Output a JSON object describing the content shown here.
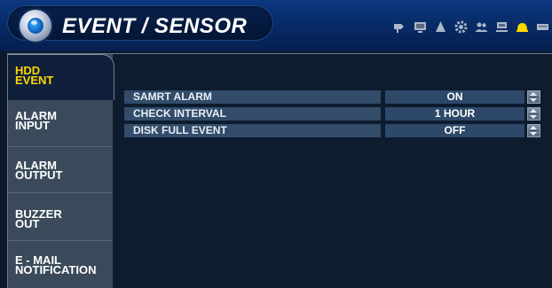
{
  "header": {
    "title": "EVENT / SENSOR",
    "icons": [
      "camera-icon",
      "monitor-icon",
      "alarm-icon",
      "gear-icon",
      "users-icon",
      "network-icon",
      "event-bell-icon",
      "device-icon"
    ],
    "active_icon_color": "#ffd700"
  },
  "sidebar": {
    "tabs": [
      {
        "line1": "HDD",
        "line2": "EVENT",
        "active": true
      },
      {
        "line1": "ALARM",
        "line2": "INPUT",
        "active": false
      },
      {
        "line1": "ALARM",
        "line2": "OUTPUT",
        "active": false
      },
      {
        "line1": "BUZZER",
        "line2": "OUT",
        "active": false
      },
      {
        "line1": "E - MAIL",
        "line2": "NOTIFICATION",
        "active": false
      }
    ]
  },
  "settings": [
    {
      "label": "SAMRT ALARM",
      "value": "ON"
    },
    {
      "label": "CHECK INTERVAL",
      "value": "1 HOUR"
    },
    {
      "label": "DISK FULL EVENT",
      "value": "OFF"
    }
  ],
  "colors": {
    "active_tab_text": "#ffd700",
    "header_bg": "#082a66",
    "sidebar_bg": "#3a4a5b"
  }
}
